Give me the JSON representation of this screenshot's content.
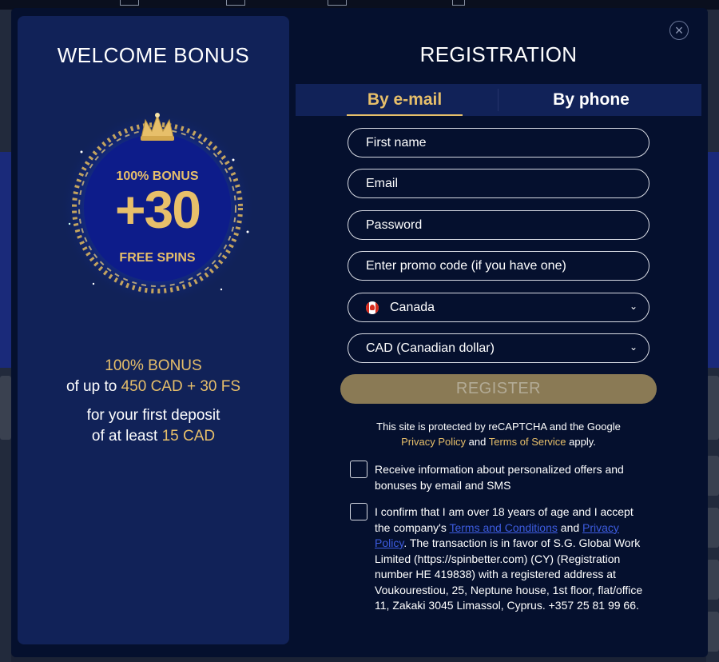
{
  "modal": {
    "close_icon": "×"
  },
  "bonus": {
    "title": "WELCOME BONUS",
    "badge_line1": "100% BONUS",
    "badge_main": "+30",
    "badge_line3": "FREE SPINS",
    "line1": "100% BONUS",
    "line2_prefix": "of up to",
    "line2_amount": "450 CAD + 30 FS",
    "line3": "for your first deposit",
    "line4_prefix": "of at least",
    "line4_amount": "15 CAD"
  },
  "registration": {
    "title": "REGISTRATION",
    "tabs": [
      {
        "label": "By e-mail",
        "active": true
      },
      {
        "label": "By phone",
        "active": false
      }
    ],
    "fields": {
      "first_name_placeholder": "First name",
      "email_placeholder": "Email",
      "password_placeholder": "Password",
      "promo_placeholder": "Enter promo code (if you have one)",
      "country_value": "Canada",
      "currency_value": "CAD (Canadian dollar)"
    },
    "register_label": "REGISTER",
    "recaptcha": {
      "text1": "This site is protected by reCAPTCHA and the Google",
      "privacy_link": "Privacy Policy",
      "and": "and",
      "terms_link": "Terms of Service",
      "apply": "apply."
    },
    "checkbox_offers": "Receive information about personalized offers and bonuses by email and SMS",
    "confirm": {
      "text1": "I confirm that I am over 18 years of age and I accept the company's",
      "terms_link": "Terms and Conditions",
      "and": "and",
      "privacy_link": "Privacy Policy",
      "text2": ". The transaction is in favor of S.G. Global Work Limited (https://spinbetter.com) (CY) (Registration number HE 419838) with a registered address at Voukourestiou, 25, Neptune house, 1st floor, flat/office 11, Zakaki 3045 Limassol, Cyprus. +357 25 81 99 66."
    }
  },
  "colors": {
    "accent_gold": "#e7bf6a",
    "modal_bg": "#05102e",
    "panel_bg": "#112258",
    "register_button": "#8a7a55",
    "link_blue": "#3d5ce0"
  }
}
